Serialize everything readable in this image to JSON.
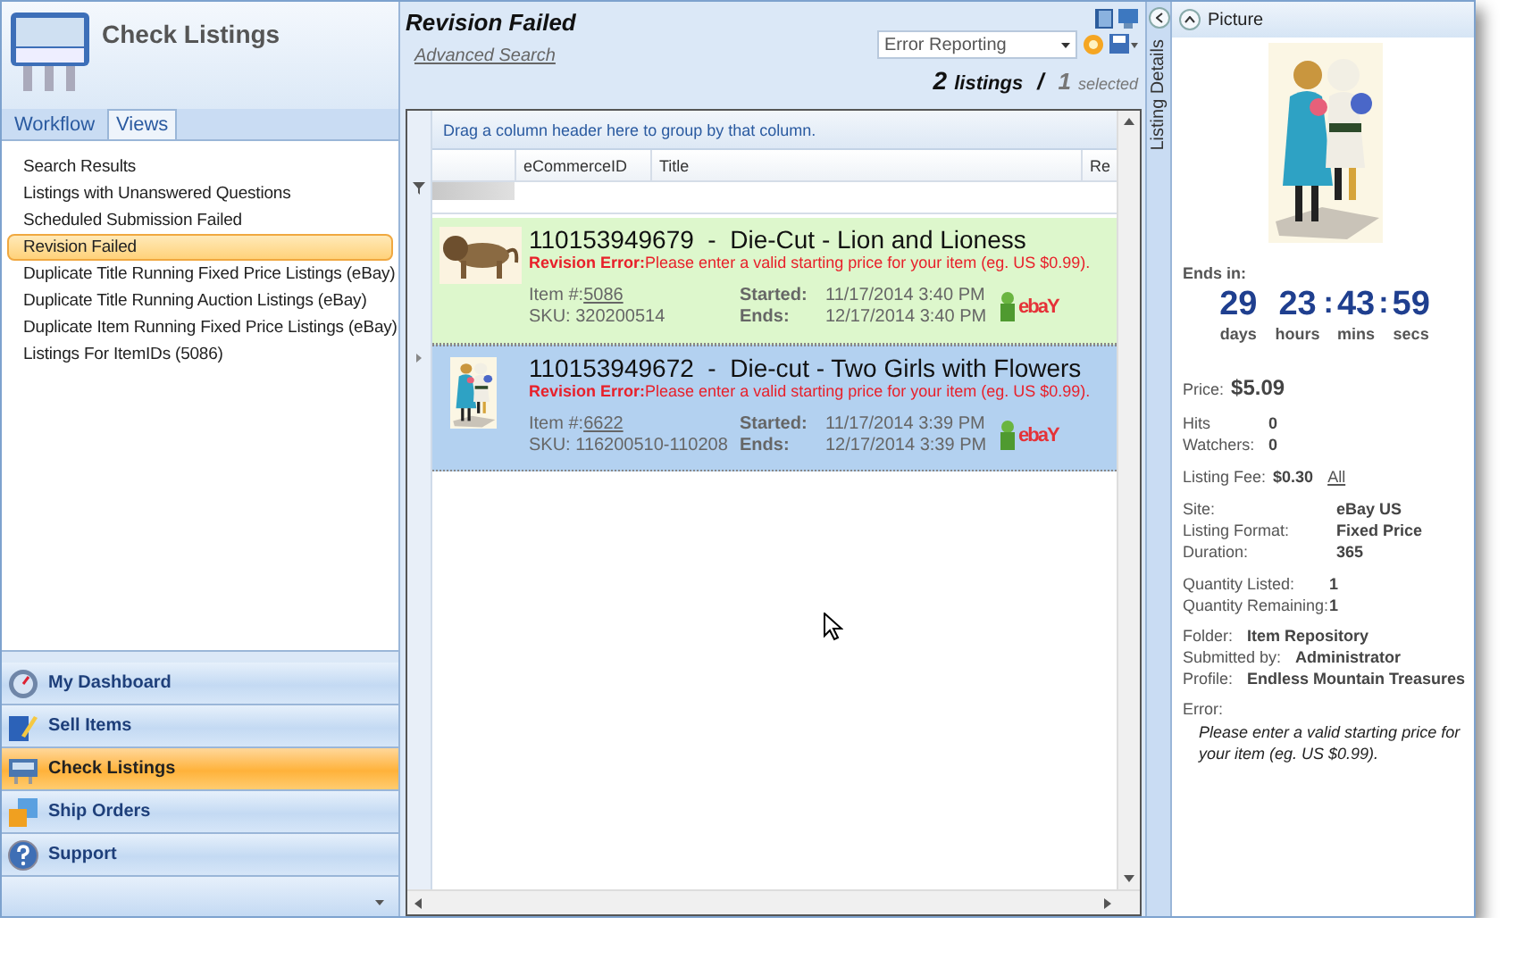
{
  "sidebar": {
    "title": "Check Listings",
    "tabs": [
      {
        "label": "Workflow",
        "selected": false
      },
      {
        "label": "Views",
        "selected": true
      }
    ],
    "views": [
      {
        "label": "Search Results",
        "selected": false
      },
      {
        "label": "Listings with Unanswered Questions",
        "selected": false
      },
      {
        "label": "Scheduled Submission Failed",
        "selected": false
      },
      {
        "label": "Revision Failed",
        "selected": true
      },
      {
        "label": "Duplicate Title Running Fixed Price Listings (eBay)",
        "selected": false
      },
      {
        "label": "Duplicate Title Running Auction Listings (eBay)",
        "selected": false
      },
      {
        "label": "Duplicate Item Running Fixed Price Listings (eBay)",
        "selected": false
      },
      {
        "label": "Listings For ItemIDs (5086)",
        "selected": false
      }
    ],
    "nav": [
      {
        "label": "My Dashboard",
        "kind": "dashboard",
        "selected": false
      },
      {
        "label": "Sell Items",
        "kind": "sell",
        "selected": false
      },
      {
        "label": "Check Listings",
        "kind": "check",
        "selected": true
      },
      {
        "label": "Ship Orders",
        "kind": "ship",
        "selected": false
      },
      {
        "label": "Support",
        "kind": "support",
        "selected": false
      }
    ]
  },
  "main": {
    "title": "Revision Failed",
    "advanced_search": "Advanced Search",
    "report": "Error Reporting",
    "count": "2",
    "count_label": "listings",
    "separator": "/",
    "selected_count": "1",
    "selected_label": "selected",
    "group_hint": "Drag a column header here to group by that column.",
    "columns": [
      "eCommerceID",
      "Title",
      "Re"
    ],
    "listings": [
      {
        "heading": "110153949679  -  Die-Cut - Lion and Lioness",
        "error_label": "Revision Error:",
        "error": "Please enter a valid starting price for your item (eg. US $0.99).",
        "item_label": "Item #:",
        "item": "5086",
        "sku": "SKU: 320200514",
        "started_label": "Started:",
        "started": "11/17/2014 3:40 PM",
        "ends_label": "Ends:",
        "ends": "12/17/2014 3:40 PM",
        "logo": "ebaY",
        "selected": false
      },
      {
        "heading": "110153949672  -  Die-cut - Two Girls with Flowers",
        "error_label": "Revision Error:",
        "error": "Please enter a valid starting price for your item (eg. US $0.99).",
        "item_label": "Item #:",
        "item": "6622",
        "sku": "SKU: 116200510-110208",
        "started_label": "Started:",
        "started": "11/17/2014 3:39 PM",
        "ends_label": "Ends:",
        "ends": "12/17/2014 3:39 PM",
        "logo": "ebaY",
        "selected": true
      }
    ]
  },
  "details": {
    "side_tab": "Listing Details",
    "section": "Picture",
    "ends_in_label": "Ends in:",
    "countdown": [
      {
        "value": "29",
        "unit": "days"
      },
      {
        "value": "23",
        "unit": "hours"
      },
      {
        "value": "43",
        "unit": "mins",
        "lead": ":"
      },
      {
        "value": "59",
        "unit": "secs",
        "lead": ":"
      }
    ],
    "price_label": "Price:",
    "price": "$5.09",
    "stats": [
      {
        "label": "Hits",
        "value": "0"
      },
      {
        "label": "Watchers:",
        "value": "0"
      }
    ],
    "fee_label": "Listing Fee:",
    "fee": "$0.30",
    "fee_link": "All",
    "groups": [
      [
        {
          "label": "Site:",
          "value": "eBay US"
        },
        {
          "label": "Listing Format:",
          "value": "Fixed Price"
        },
        {
          "label": "Duration:",
          "value": "365"
        }
      ],
      [
        {
          "label": "Quantity Listed:",
          "value": "1"
        },
        {
          "label": "Quantity Remaining:",
          "value": "1"
        }
      ]
    ],
    "owner": [
      {
        "label": "Folder:",
        "value": "Item Repository"
      },
      {
        "label": "Submitted by:",
        "value": "Administrator"
      },
      {
        "label": "Profile:",
        "value": "Endless Mountain Treasures"
      }
    ],
    "error_label": "Error:",
    "error": "Please enter a valid starting price for your item (eg. US $0.99)."
  }
}
